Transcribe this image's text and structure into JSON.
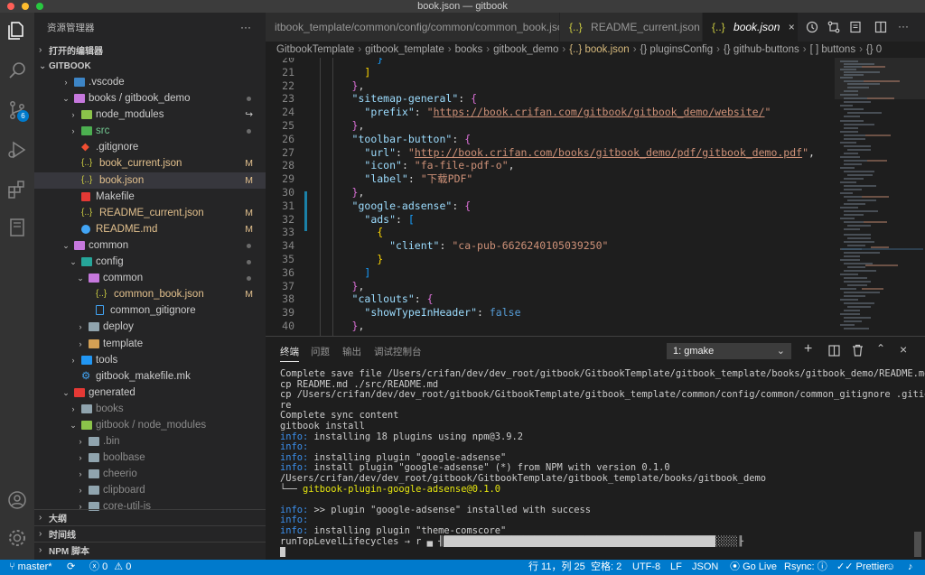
{
  "window": {
    "title": "book.json — gitbook"
  },
  "activity": {
    "scm_badge": "6"
  },
  "sidebar": {
    "title": "资源管理器",
    "more": "···",
    "open_editors": "打开的编辑器",
    "root": "GITBOOK",
    "tree": [
      {
        "label": "vscode",
        "prefix": ".",
        "depth": 1,
        "arrow": "›",
        "icon": "folder-vscode",
        "color": "#3d85c6",
        "status": ""
      },
      {
        "label": "books / gitbook_demo",
        "depth": 1,
        "arrow": "⌄",
        "icon": "folder-open",
        "color": "#c678dd",
        "status": "dot"
      },
      {
        "label": "node_modules",
        "depth": 2,
        "arrow": "›",
        "icon": "folder-node",
        "color": "#8bc34a",
        "status": "↪"
      },
      {
        "label": "src",
        "depth": 2,
        "arrow": "›",
        "icon": "folder-src",
        "color": "#4caf50",
        "status": "dot",
        "label_color": "#73c991"
      },
      {
        "label": ".gitignore",
        "depth": 2,
        "arrow": "",
        "icon": "git",
        "color": "#f14e32",
        "status": ""
      },
      {
        "label": "book_current.json",
        "depth": 2,
        "arrow": "",
        "icon": "json",
        "color": "#cbcb41",
        "status": "M",
        "label_color": "#e2c08d"
      },
      {
        "label": "book.json",
        "depth": 2,
        "arrow": "",
        "icon": "json",
        "color": "#cbcb41",
        "status": "M",
        "label_color": "#e2c08d",
        "selected": true
      },
      {
        "label": "Makefile",
        "depth": 2,
        "arrow": "",
        "icon": "makefile",
        "color": "#e53935",
        "status": ""
      },
      {
        "label": "README_current.json",
        "depth": 2,
        "arrow": "",
        "icon": "json",
        "color": "#cbcb41",
        "status": "M",
        "label_color": "#e2c08d"
      },
      {
        "label": "README.md",
        "depth": 2,
        "arrow": "",
        "icon": "info",
        "color": "#42a5f5",
        "status": "M",
        "label_color": "#e2c08d"
      },
      {
        "label": "common",
        "depth": 1,
        "arrow": "⌄",
        "icon": "folder-open",
        "color": "#c678dd",
        "status": "dot"
      },
      {
        "label": "config",
        "depth": 2,
        "arrow": "⌄",
        "icon": "folder-config",
        "color": "#26a69a",
        "status": "dot"
      },
      {
        "label": "common",
        "depth": 3,
        "arrow": "⌄",
        "icon": "folder-open",
        "color": "#c678dd",
        "status": "dot"
      },
      {
        "label": "common_book.json",
        "depth": 4,
        "arrow": "",
        "icon": "json",
        "color": "#cbcb41",
        "status": "M",
        "label_color": "#e2c08d"
      },
      {
        "label": "common_gitignore",
        "depth": 4,
        "arrow": "",
        "icon": "file",
        "color": "#42a5f5",
        "status": ""
      },
      {
        "label": "deploy",
        "depth": 3,
        "arrow": "›",
        "icon": "folder",
        "color": "#90a4ae",
        "status": ""
      },
      {
        "label": "template",
        "depth": 3,
        "arrow": "›",
        "icon": "folder-template",
        "color": "#d4a054",
        "status": ""
      },
      {
        "label": "tools",
        "depth": 2,
        "arrow": "›",
        "icon": "folder-tools",
        "color": "#2196f3",
        "status": ""
      },
      {
        "label": "gitbook_makefile.mk",
        "depth": 2,
        "arrow": "",
        "icon": "gear",
        "color": "#42a5f5",
        "status": ""
      },
      {
        "label": "generated",
        "depth": 1,
        "arrow": "⌄",
        "icon": "folder-generated",
        "color": "#e53935",
        "status": ""
      },
      {
        "label": "books",
        "depth": 2,
        "arrow": "›",
        "icon": "folder",
        "color": "#90a4ae",
        "status": "",
        "dim": true
      },
      {
        "label": "gitbook / node_modules",
        "depth": 2,
        "arrow": "⌄",
        "icon": "folder-node",
        "color": "#8bc34a",
        "status": "",
        "dim": true
      },
      {
        "label": ".bin",
        "depth": 3,
        "arrow": "›",
        "icon": "folder",
        "color": "#90a4ae",
        "status": "",
        "dim": true
      },
      {
        "label": "boolbase",
        "depth": 3,
        "arrow": "›",
        "icon": "folder",
        "color": "#90a4ae",
        "status": "",
        "dim": true
      },
      {
        "label": "cheerio",
        "depth": 3,
        "arrow": "›",
        "icon": "folder",
        "color": "#90a4ae",
        "status": "",
        "dim": true
      },
      {
        "label": "clipboard",
        "depth": 3,
        "arrow": "›",
        "icon": "folder",
        "color": "#90a4ae",
        "status": "",
        "dim": true
      },
      {
        "label": "core-util-is",
        "depth": 3,
        "arrow": "›",
        "icon": "folder",
        "color": "#90a4ae",
        "status": "",
        "dim": true
      }
    ],
    "outline": "大纲",
    "timeline": "时间线",
    "npm": "NPM 脚本"
  },
  "tabs": [
    {
      "label": "itbook_template/common/config/common/common_book.json",
      "icon": ""
    },
    {
      "label": "README_current.json",
      "icon": "{..}"
    },
    {
      "label": "book.json",
      "icon": "{..}",
      "active": true
    }
  ],
  "breadcrumb": [
    "GitbookTemplate",
    "gitbook_template",
    "books",
    "gitbook_demo",
    "{..} book.json",
    "{} pluginsConfig",
    "{} github-buttons",
    "[ ] buttons",
    "{} 0"
  ],
  "editor": {
    "lines": [
      {
        "n": "20",
        "html": "          <span class='b3'>}</span>"
      },
      {
        "n": "21",
        "html": "        <span class='b1'>]</span>"
      },
      {
        "n": "22",
        "html": "      <span class='b2'>}</span>,"
      },
      {
        "n": "23",
        "html": "      <span class='k'>\"sitemap-general\"</span>: <span class='b2'>{</span>"
      },
      {
        "n": "24",
        "html": "        <span class='k'>\"prefix\"</span>: <span class='s'>\"</span><span class='u'>https://book.crifan.com/gitbook/gitbook_demo/website/</span><span class='s'>\"</span>"
      },
      {
        "n": "25",
        "html": "      <span class='b2'>}</span>,"
      },
      {
        "n": "26",
        "html": "      <span class='k'>\"toolbar-button\"</span>: <span class='b2'>{</span>"
      },
      {
        "n": "27",
        "html": "        <span class='k'>\"url\"</span>: <span class='s'>\"</span><span class='u'>http://book.crifan.com/books/gitbook_demo/pdf/gitbook_demo.pdf</span><span class='s'>\"</span>,"
      },
      {
        "n": "28",
        "html": "        <span class='k'>\"icon\"</span>: <span class='s'>\"fa-file-pdf-o\"</span>,"
      },
      {
        "n": "29",
        "html": "        <span class='k'>\"label\"</span>: <span class='s'>\"下载PDF\"</span>"
      },
      {
        "n": "30",
        "html": "      <span class='b2'>}</span>,"
      },
      {
        "n": "31",
        "html": "      <span class='k'>\"google-adsense\"</span>: <span class='b2'>{</span>"
      },
      {
        "n": "32",
        "html": "        <span class='k'>\"ads\"</span>: <span class='b3'>[</span>"
      },
      {
        "n": "33",
        "html": "          <span class='b1'>{</span>"
      },
      {
        "n": "34",
        "html": "            <span class='k'>\"client\"</span>: <span class='s'>\"ca-pub-6626240105039250\"</span>"
      },
      {
        "n": "35",
        "html": "          <span class='b1'>}</span>"
      },
      {
        "n": "36",
        "html": "        <span class='b3'>]</span>"
      },
      {
        "n": "37",
        "html": "      <span class='b2'>}</span>,"
      },
      {
        "n": "38",
        "html": "      <span class='k'>\"callouts\"</span>: <span class='b2'>{</span>"
      },
      {
        "n": "39",
        "html": "        <span class='k'>\"showTypeInHeader\"</span>: <span class='kw'>false</span>"
      },
      {
        "n": "40",
        "html": "      <span class='b2'>}</span>,"
      }
    ]
  },
  "panel": {
    "tabs": [
      "终端",
      "问题",
      "输出",
      "调试控制台"
    ],
    "terminal_select": "1: gmake",
    "terminal_lines": [
      {
        "html": "Complete save file /Users/crifan/dev/dev_root/gitbook/GitbookTemplate/gitbook_template/books/gitbook_demo/README.md"
      },
      {
        "html": "cp README.md ./src/README.md"
      },
      {
        "html": "cp /Users/crifan/dev/dev_root/gitbook/GitbookTemplate/gitbook_template/common/config/common/common_gitignore .gitigno"
      },
      {
        "html": "re"
      },
      {
        "html": "Complete sync content"
      },
      {
        "html": "gitbook install"
      },
      {
        "html": "<span class='info'>info:</span> installing 18 plugins using npm@3.9.2"
      },
      {
        "html": "<span class='info'>info:</span>"
      },
      {
        "html": "<span class='info'>info:</span> installing plugin \"google-adsense\""
      },
      {
        "html": "<span class='info'>info:</span> install plugin \"google-adsense\" (*) from NPM with version 0.1.0"
      },
      {
        "html": "/Users/crifan/dev/dev_root/gitbook/GitbookTemplate/gitbook_template/books/gitbook_demo"
      },
      {
        "html": "└── <span class='pkg'>gitbook-plugin-google-adsense@0.1.0</span>"
      },
      {
        "html": " "
      },
      {
        "html": "<span class='info'>info:</span> &gt;&gt; plugin \"google-adsense\" installed with success"
      },
      {
        "html": "<span class='info'>info:</span>"
      },
      {
        "html": "<span class='info'>info:</span> installing plugin \"theme-comscore\""
      },
      {
        "html": "runTopLevelLifecycles → r ▄ ╢<span style='background:#cccccc;color:#cccccc'>████████████████████████████████████████████████</span>░░░░╟"
      }
    ]
  },
  "statusbar": {
    "branch": "master*",
    "errors": "0",
    "warnings": "0",
    "position": "行 11，列 25",
    "spaces": "空格: 2",
    "encoding": "UTF-8",
    "eol": "LF",
    "language": "JSON",
    "golive": "Go Live",
    "rsync": "Rsync:",
    "prettier": "Prettier"
  },
  "colors": {
    "accent": "#007acc",
    "activity": "#333333",
    "sidebar": "#252526",
    "editor": "#1e1e1e"
  }
}
